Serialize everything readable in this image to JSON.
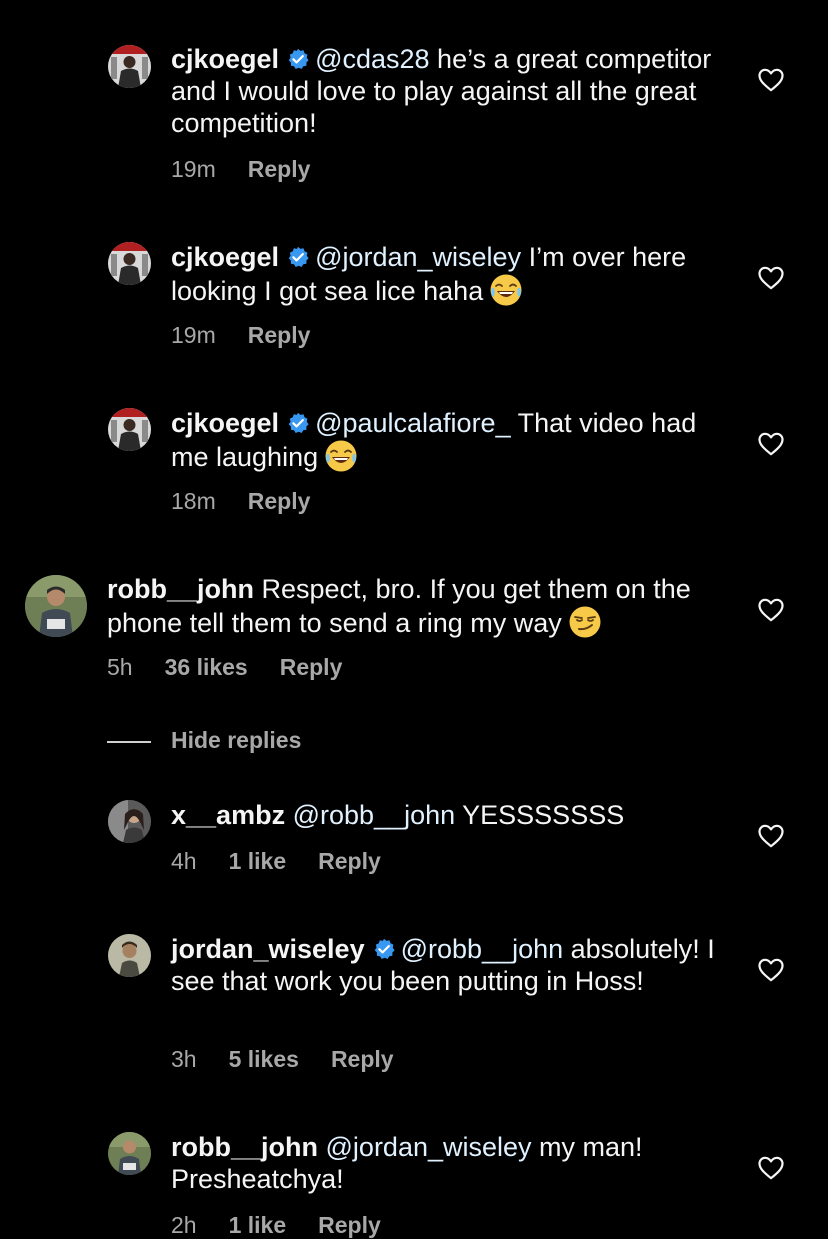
{
  "colors": {
    "background": "#000000",
    "text_primary": "#f5f5f5",
    "text_secondary": "#a8a8a8",
    "verified_blue": "#3897f0"
  },
  "comments": [
    {
      "username": "cjkoegel",
      "verified": true,
      "mention": "@cdas28",
      "text": " he’s a great competitor and I would love to play against all the great competition!",
      "time": "19m",
      "likes": "",
      "reply": "Reply"
    },
    {
      "username": "cjkoegel",
      "verified": true,
      "mention": "@jordan_wiseley",
      "text": " I’m over here looking I got sea lice haha",
      "emoji": "face-with-tears-of-joy",
      "time": "19m",
      "likes": "",
      "reply": "Reply"
    },
    {
      "username": "cjkoegel",
      "verified": true,
      "mention": "@paulcalafiore_",
      "text": " That video had me laughing",
      "emoji": "face-with-tears-of-joy",
      "time": "18m",
      "likes": "",
      "reply": "Reply"
    },
    {
      "username": "robb__john",
      "verified": false,
      "mention": "",
      "text": " Respect, bro. If you get them on the phone tell them to send a ring my way",
      "emoji": "smirking-face",
      "time": "5h",
      "likes": "36 likes",
      "reply": "Reply"
    },
    {
      "username": "x__ambz",
      "verified": false,
      "mention": "@robb__john",
      "text": " YESSSSSSS",
      "time": "4h",
      "likes": "1 like",
      "reply": "Reply"
    },
    {
      "username": "jordan_wiseley",
      "verified": true,
      "mention": "@robb__john",
      "text": " absolutely! I see that work you been putting in Hoss!",
      "time": "3h",
      "likes": "5 likes",
      "reply": "Reply"
    },
    {
      "username": "robb__john",
      "verified": false,
      "mention": "@jordan_wiseley",
      "text": " my man! Presheatchya!",
      "time": "2h",
      "likes": "1 like",
      "reply": "Reply"
    }
  ],
  "hide_replies_label": "Hide replies",
  "icons": {
    "like": "heart-outline-icon",
    "verified": "verified-badge-icon"
  }
}
